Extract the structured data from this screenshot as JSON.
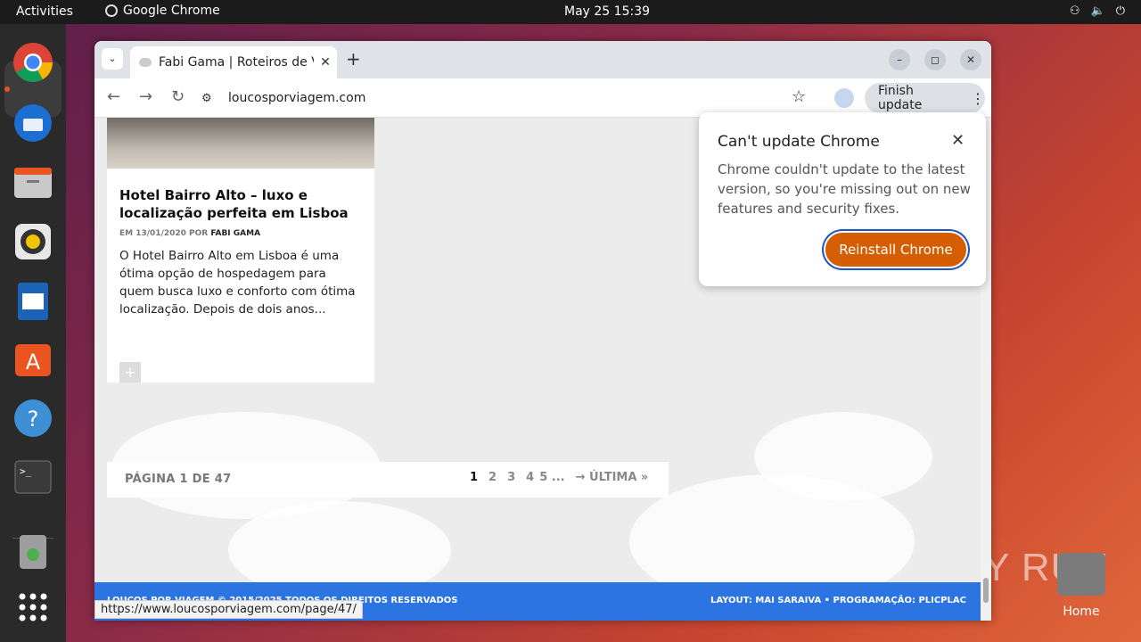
{
  "topbar": {
    "activities": "Activities",
    "app_name": "Google Chrome",
    "datetime": "May 25  15:39",
    "tray_icons": [
      "network-icon",
      "volume-icon",
      "power-icon"
    ]
  },
  "dock": {
    "apps": [
      "Google Chrome",
      "Thunderbird Mail",
      "Files",
      "Rhythmbox",
      "LibreOffice Writer",
      "Ubuntu Software",
      "Help",
      "Terminal",
      "Trash",
      "Show Applications"
    ]
  },
  "desktop": {
    "home_label": "Home",
    "watermark": "ANY RUN"
  },
  "browser": {
    "tab_title": "Fabi Gama | Roteiros de V",
    "url": "loucosporviagem.com",
    "finish_update_label": "Finish update",
    "status_url": "https://www.loucosporviagem.com/page/47/"
  },
  "page": {
    "post": {
      "title": "Hotel Bairro Alto – luxo e localização perfeita em Lisboa",
      "meta_prefix": "EM 13/01/2020 POR ",
      "author": "FABI GAMA",
      "excerpt": "O Hotel Bairro Alto em Lisboa é uma ótima opção de hospedagem para quem busca luxo e conforto com ótima localização. Depois de dois anos..."
    },
    "pagination": {
      "label": "PÁGINA 1 DE 47",
      "current": "1",
      "pages": [
        "2",
        "3",
        "4",
        "5"
      ],
      "ellipsis": "...",
      "last": "→ ÚLTIMA »"
    },
    "footer": {
      "left": "LOUCOS POR VIAGEM © 2015/2025 TODOS OS DIREITOS RESERVADOS",
      "right": "LAYOUT: MAI SARAIVA  •  PROGRAMAÇÃO: PLICPLAC"
    }
  },
  "popup": {
    "title": "Can't update Chrome",
    "body": "Chrome couldn't update to the latest version, so you're missing out on new features and security fixes.",
    "button": "Reinstall Chrome"
  },
  "colors": {
    "accent_orange": "#d55f00",
    "footer_blue": "#2b74e2",
    "ubuntu_orange": "#e95420"
  }
}
